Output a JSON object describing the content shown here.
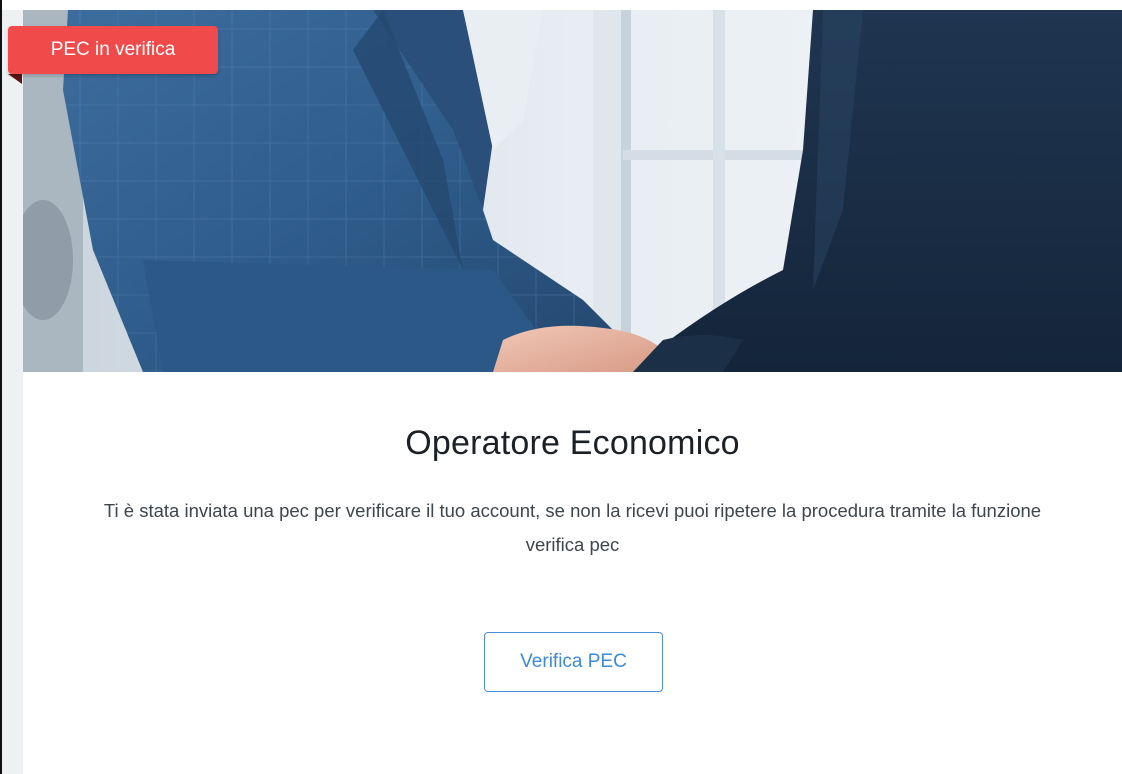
{
  "badge": {
    "label": "PEC in verifica",
    "color": "#f04a4a"
  },
  "hero": {
    "image": "business-handshake-photo"
  },
  "card": {
    "title": "Operatore Economico",
    "description": "Ti è stata inviata una pec per verificare il tuo account, se non la ricevi puoi ripetere la procedura tramite la funzione verifica pec",
    "button_label": "Verifica PEC"
  },
  "colors": {
    "accent": "#3d8ad6",
    "badge": "#f04a4a",
    "title": "#1b2126",
    "text": "#3e464d"
  }
}
